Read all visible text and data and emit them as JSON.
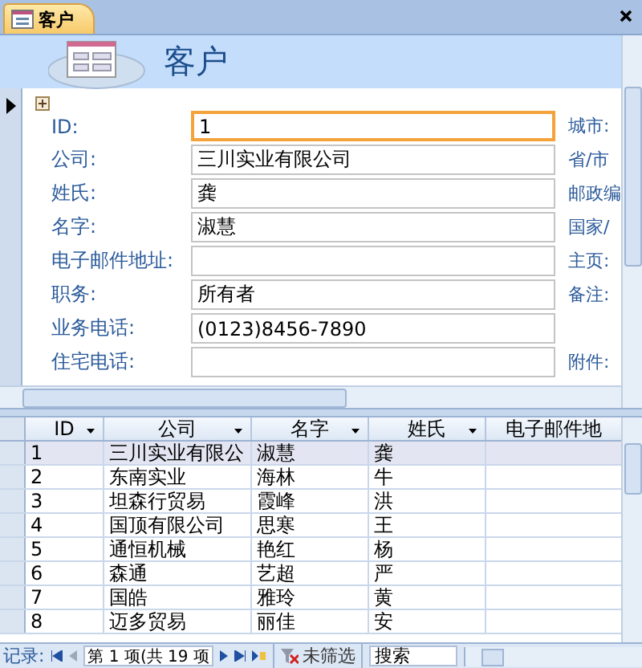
{
  "tab": {
    "title": "客户"
  },
  "header": {
    "title": "客户"
  },
  "form": {
    "fields": [
      {
        "label": "ID:",
        "value": "1",
        "focused": true,
        "side_label": "城市:"
      },
      {
        "label": "公司:",
        "value": "三川实业有限公司",
        "focused": false,
        "side_label": "省/市"
      },
      {
        "label": "姓氏:",
        "value": "龚",
        "focused": false,
        "side_label": "邮政编"
      },
      {
        "label": "名字:",
        "value": "淑慧",
        "focused": false,
        "side_label": "国家/"
      },
      {
        "label": "电子邮件地址:",
        "focused": false,
        "side_label": "主页:"
      },
      {
        "label": "职务:",
        "value": "所有者",
        "focused": false,
        "side_label": "备注:"
      },
      {
        "label": "业务电话:",
        "value": "(0123)8456-7890",
        "focused": false
      },
      {
        "label": "住宅电话:",
        "focused": false,
        "side_label": "附件:"
      }
    ]
  },
  "datasheet": {
    "columns": [
      "ID",
      "公司",
      "名字",
      "姓氏",
      "电子邮件地"
    ],
    "rows": [
      {
        "cells": [
          "1",
          "三川实业有限公",
          "淑慧",
          "龚"
        ],
        "selected": true
      },
      {
        "cells": [
          "2",
          "东南实业",
          "海林",
          "牛"
        ],
        "selected": false
      },
      {
        "cells": [
          "3",
          "坦森行贸易",
          "霞峰",
          "洪"
        ],
        "selected": false
      },
      {
        "cells": [
          "4",
          "国顶有限公司",
          "思寒",
          "王"
        ],
        "selected": false
      },
      {
        "cells": [
          "5",
          "通恒机械",
          "艳红",
          "杨"
        ],
        "selected": false
      },
      {
        "cells": [
          "6",
          "森通",
          "艺超",
          "严"
        ],
        "selected": false
      },
      {
        "cells": [
          "7",
          "国皓",
          "雅玲",
          "黄"
        ],
        "selected": false
      },
      {
        "cells": [
          "8",
          "迈多贸易",
          "丽佳",
          "安"
        ],
        "selected": false
      }
    ]
  },
  "navigator": {
    "label": "记录:",
    "position": "第 1 项(共 19 项",
    "filter": "未筛选",
    "search_placeholder": "搜索"
  }
}
